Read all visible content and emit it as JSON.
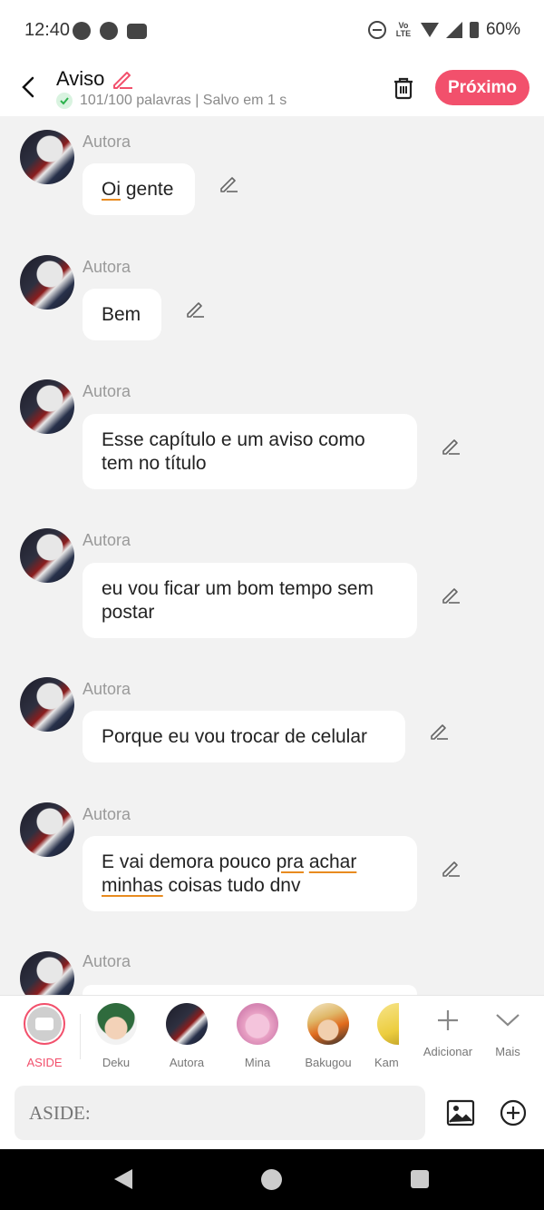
{
  "status_bar": {
    "time": "12:40",
    "battery": "60%",
    "network": "Vo LTE"
  },
  "header": {
    "title": "Aviso",
    "subtitle": "101/100 palavras | Salvo em 1 s",
    "next_label": "Próximo"
  },
  "messages": [
    {
      "author": "Autora",
      "text": "Oi gente"
    },
    {
      "author": "Autora",
      "text": "Bem"
    },
    {
      "author": "Autora",
      "text": "Esse capítulo e um aviso como tem no título"
    },
    {
      "author": "Autora",
      "text": "eu vou ficar um bom tempo sem postar"
    },
    {
      "author": "Autora",
      "text": "Porque eu vou trocar de celular"
    },
    {
      "author": "Autora",
      "text": "E vai demora pouco pra achar minhas coisas tudo dnv"
    },
    {
      "author": "Autora",
      "text": ""
    }
  ],
  "characters": [
    {
      "name": "ASIDE",
      "active": true
    },
    {
      "name": "Deku"
    },
    {
      "name": "Autora"
    },
    {
      "name": "Mina"
    },
    {
      "name": "Bakugou"
    },
    {
      "name": "Kam"
    }
  ],
  "actions": {
    "add_label": "Adicionar",
    "more_label": "Mais"
  },
  "input": {
    "placeholder": "ASIDE:"
  },
  "colors": {
    "accent": "#f2506c",
    "background": "#f2f2f2",
    "underline": "#e88b1f"
  }
}
